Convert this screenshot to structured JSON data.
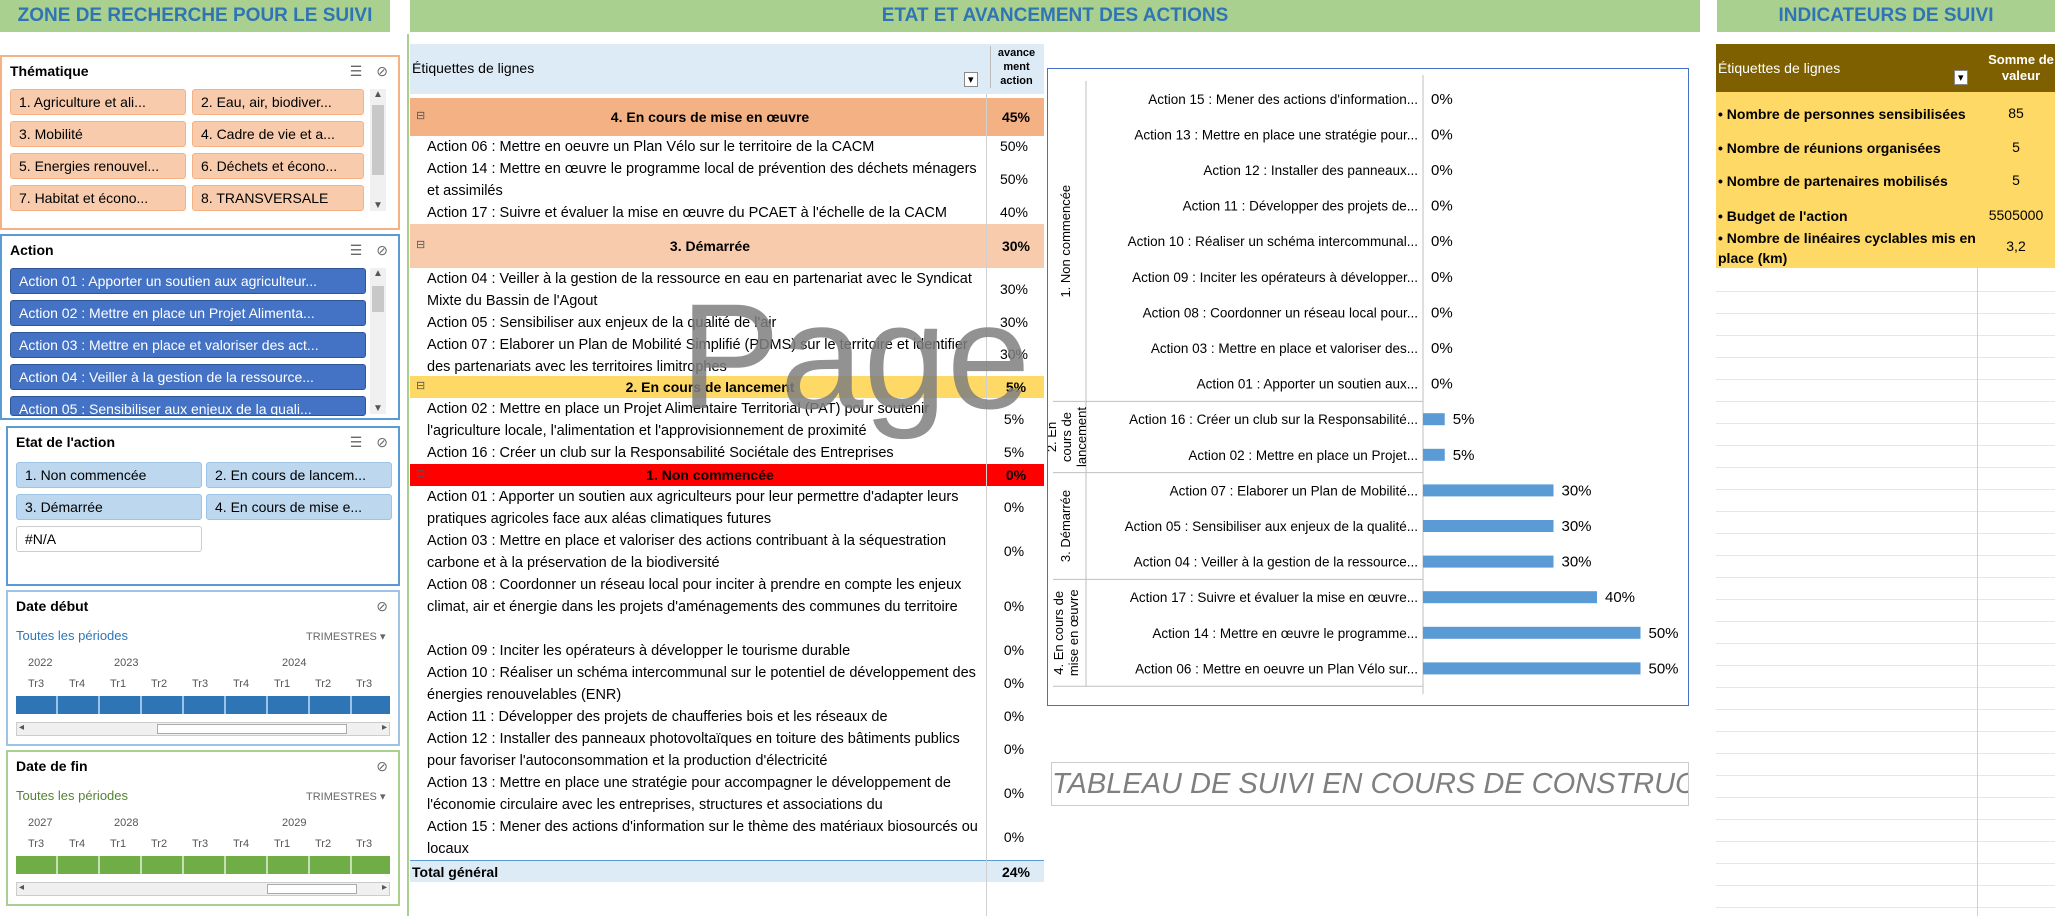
{
  "headers": {
    "search": "ZONE DE RECHERCHE POUR LE SUIVI",
    "etat": "ETAT ET AVANCEMENT DES ACTIONS",
    "indicateurs": "INDICATEURS DE SUIVI"
  },
  "slicer_thematique": {
    "title": "Thématique",
    "items": [
      "1. Agriculture et ali...",
      "2. Eau, air, biodiver...",
      "3. Mobilité",
      "4. Cadre de vie et a...",
      "5. Energies renouvel...",
      "6. Déchets et écono...",
      "7. Habitat et écono...",
      "8. TRANSVERSALE"
    ]
  },
  "slicer_action": {
    "title": "Action",
    "items": [
      "Action 01 : Apporter un soutien aux agriculteur...",
      "Action 02 : Mettre en place un Projet Alimenta...",
      "Action 03 : Mettre en place et valoriser des act...",
      "Action 04 : Veiller à la gestion de la ressource...",
      "Action 05 : Sensibiliser aux enjeux de la quali..."
    ]
  },
  "slicer_etat": {
    "title": "Etat de l'action",
    "items": [
      "1. Non commencée",
      "2. En cours de lancem...",
      "3. Démarrée",
      "4. En cours de mise e...",
      "#N/A"
    ]
  },
  "timeline_debut": {
    "title": "Date début",
    "all": "Toutes les périodes",
    "level": "TRIMESTRES",
    "years": [
      "2022",
      "2023",
      "2024"
    ],
    "quarters": [
      "Tr3",
      "Tr4",
      "Tr1",
      "Tr2",
      "Tr3",
      "Tr4",
      "Tr1",
      "Tr2",
      "Tr3"
    ]
  },
  "timeline_fin": {
    "title": "Date de fin",
    "all": "Toutes les périodes",
    "level": "TRIMESTRES",
    "years": [
      "2027",
      "2028",
      "2029"
    ],
    "quarters": [
      "Tr3",
      "Tr4",
      "Tr1",
      "Tr2",
      "Tr3",
      "Tr4",
      "Tr1",
      "Tr2",
      "Tr3"
    ]
  },
  "pivot": {
    "row_labels": "Étiquettes de lignes",
    "col_header": [
      "avance",
      "ment",
      "action"
    ],
    "groups": [
      {
        "label": "4. En cours de mise en œuvre",
        "value": "45%",
        "color": "#f4b183"
      },
      {
        "label": "3. Démarrée",
        "value": "30%",
        "color": "#f8cbad"
      },
      {
        "label": "2. En cours de lancement",
        "value": "5%",
        "color": "#ffd966"
      },
      {
        "label": "1. Non commencée",
        "value": "0%",
        "color": "#ff0000"
      }
    ],
    "rows": [
      {
        "text": "Action 06 : Mettre en oeuvre un Plan Vélo sur le territoire de la CACM",
        "value": "50%"
      },
      {
        "text": "Action 14 : Mettre en œuvre le programme local de prévention des déchets ménagers et assimilés",
        "value": "50%"
      },
      {
        "text": "Action 17 : Suivre et évaluer la mise en œuvre du PCAET à l'échelle de la CACM",
        "value": "40%"
      },
      {
        "text": "Action 04 : Veiller à la gestion de la ressource en eau en partenariat avec le Syndicat Mixte du Bassin de l'Agout",
        "value": "30%"
      },
      {
        "text": "Action 05 : Sensibiliser aux enjeux de la qualité de l'air",
        "value": "30%"
      },
      {
        "text": "Action 07 : Elaborer un Plan de Mobilité Simplifié (PDMS) sur le territoire et identifier des partenariats avec les territoires limitrophes",
        "value": "30%"
      },
      {
        "text": "Action 02 : Mettre en place un Projet Alimentaire Territorial (PAT) pour soutenir l'agriculture locale, l'alimentation et l'approvisionnement de proximité",
        "value": "5%"
      },
      {
        "text": "Action 16 : Créer un club sur la Responsabilité Sociétale des Entreprises",
        "value": "5%"
      },
      {
        "text": "Action 01 : Apporter un soutien aux agriculteurs pour leur permettre d'adapter leurs pratiques agricoles face aux aléas climatiques futures",
        "value": "0%"
      },
      {
        "text": "Action 03 : Mettre en place et valoriser des actions contribuant à la séquestration carbone et à la préservation de la biodiversité",
        "value": "0%"
      },
      {
        "text": "Action 08 : Coordonner un réseau local pour inciter à prendre en compte les enjeux climat, air et énergie dans les projets d'aménagements des communes du territoire",
        "value": "0%"
      },
      {
        "text": "Action 09 : Inciter les opérateurs à développer le tourisme durable",
        "value": "0%"
      },
      {
        "text": "Action 10 : Réaliser un schéma intercommunal sur le potentiel de développement des énergies renouvelables (ENR)",
        "value": "0%"
      },
      {
        "text": "Action 11 : Développer des projets de chaufferies bois et les réseaux de",
        "value": "0%"
      },
      {
        "text": "Action 12 : Installer des panneaux photovoltaïques en toiture des bâtiments publics pour favoriser l'autoconsommation et la production d'électricité",
        "value": "0%"
      },
      {
        "text": "Action 13 : Mettre en place une stratégie pour accompagner le développement de l'économie circulaire avec les entreprises, structures et associations du",
        "value": "0%"
      },
      {
        "text": "Action 15 : Mener des actions d'information sur le thème des matériaux biosourcés ou locaux",
        "value": "0%"
      }
    ],
    "total_label": "Total général",
    "total_value": "24%"
  },
  "watermark": "Page",
  "chart_data": {
    "type": "bar",
    "orientation": "horizontal",
    "groups": [
      "4. En cours de mise en œuvre",
      "3. Démarrée",
      "2. En cours de lancement",
      "1. Non commencée"
    ],
    "categories": [
      "Action 15 : Mener des actions d'information...",
      "Action 13 : Mettre en place une stratégie pour...",
      "Action 12 : Installer des panneaux...",
      "Action 11 : Développer des projets de...",
      "Action 10 : Réaliser un schéma intercommunal...",
      "Action 09 : Inciter les opérateurs à développer...",
      "Action 08 : Coordonner un réseau local pour...",
      "Action 03 : Mettre en place et valoriser des...",
      "Action 01 : Apporter un soutien aux...",
      "Action 16 : Créer un club sur la Responsabilité...",
      "Action 02 : Mettre en place un Projet...",
      "Action 07 : Elaborer un Plan de Mobilité...",
      "Action 05 : Sensibiliser aux enjeux de la qualité...",
      "Action 04 : Veiller à la gestion de la ressource...",
      "Action 17 : Suivre et évaluer la mise en œuvre...",
      "Action 14 : Mettre en œuvre le programme...",
      "Action 06 : Mettre en oeuvre un Plan Vélo sur..."
    ],
    "category_group": [
      "1. Non commencée",
      "1. Non commencée",
      "1. Non commencée",
      "1. Non commencée",
      "1. Non commencée",
      "1. Non commencée",
      "1. Non commencée",
      "1. Non commencée",
      "1. Non commencée",
      "2. En cours de lancement",
      "2. En cours de lancement",
      "3. Démarrée",
      "3. Démarrée",
      "3. Démarrée",
      "4. En cours de mise en œuvre",
      "4. En cours de mise en œuvre",
      "4. En cours de mise en œuvre"
    ],
    "values": [
      0,
      0,
      0,
      0,
      0,
      0,
      0,
      0,
      0,
      5,
      5,
      30,
      30,
      30,
      40,
      50,
      50
    ],
    "value_labels": [
      "0%",
      "0%",
      "0%",
      "0%",
      "0%",
      "0%",
      "0%",
      "0%",
      "0%",
      "5%",
      "5%",
      "30%",
      "30%",
      "30%",
      "40%",
      "50%",
      "50%"
    ],
    "color": "#5b9bd5"
  },
  "construction": "TABLEAU DE SUIVI EN COURS DE CONSTRUCTION...",
  "indicators": {
    "row_labels": "Étiquettes de lignes",
    "value_header": "Somme de valeur",
    "rows": [
      {
        "label": "• Nombre de personnes sensibilisées",
        "value": "85"
      },
      {
        "label": "• Nombre de réunions organisées",
        "value": "5"
      },
      {
        "label": "• Nombre de partenaires mobilisés",
        "value": "5"
      },
      {
        "label": "• Budget de l'action",
        "value": "5505000"
      },
      {
        "label": "• Nombre de linéaires cyclables mis en place (km)",
        "value": "3,2"
      }
    ]
  },
  "colors": {
    "header_green": "#a9d08e",
    "header_blue_text": "#2f75b5",
    "slicer_orange": "#f8cbad",
    "slicer_blue": "#4472c4",
    "slicer_lightblue": "#bdd7ee",
    "timeline_blue": "#2e75b6",
    "timeline_green": "#70ad47",
    "ind_header": "#7f6000",
    "ind_rows": "#ffd966"
  }
}
